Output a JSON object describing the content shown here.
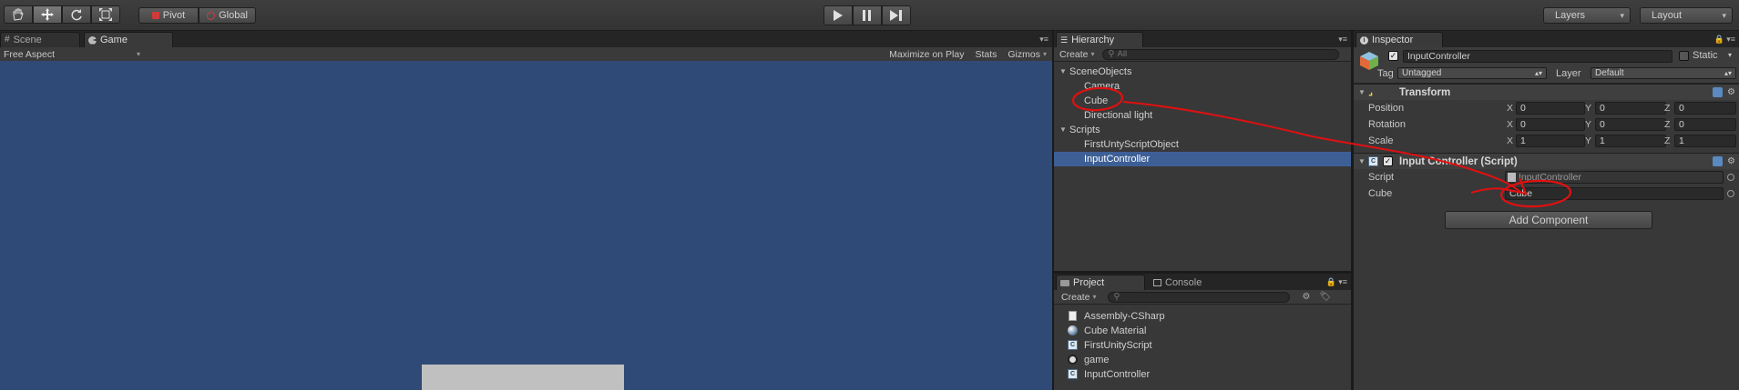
{
  "toolbar": {
    "tools": [
      "hand-tool",
      "move-tool",
      "rotate-tool",
      "scale-tool"
    ],
    "pivot_label": "Pivot",
    "global_label": "Global",
    "layers_label": "Layers",
    "layout_label": "Layout"
  },
  "scene_panel": {
    "tabs": {
      "scene": "Scene",
      "game": "Game"
    },
    "aspect": "Free Aspect",
    "maximize": "Maximize on Play",
    "stats": "Stats",
    "gizmos": "Gizmos"
  },
  "hierarchy": {
    "title": "Hierarchy",
    "create": "Create",
    "search_placeholder": "All",
    "items": [
      {
        "label": "SceneObjects"
      },
      {
        "label": "Camera"
      },
      {
        "label": "Cube"
      },
      {
        "label": "Directional light"
      },
      {
        "label": "Scripts"
      },
      {
        "label": "FirstUntyScriptObject"
      },
      {
        "label": "InputController"
      }
    ]
  },
  "project": {
    "tabs": {
      "project": "Project",
      "console": "Console"
    },
    "create": "Create",
    "items": [
      {
        "label": "Assembly-CSharp",
        "icon": "document-icon"
      },
      {
        "label": "Cube Material",
        "icon": "material-sphere-icon"
      },
      {
        "label": "FirstUnityScript",
        "icon": "csharp-script-icon"
      },
      {
        "label": "game",
        "icon": "unity-scene-icon"
      },
      {
        "label": "InputController",
        "icon": "csharp-script-icon"
      }
    ]
  },
  "inspector": {
    "title": "Inspector",
    "object_name": "InputController",
    "static_label": "Static",
    "tag_label": "Tag",
    "tag_value": "Untagged",
    "layer_label": "Layer",
    "layer_value": "Default",
    "transform": {
      "title": "Transform",
      "position_label": "Position",
      "rotation_label": "Rotation",
      "scale_label": "Scale",
      "position": {
        "x": "0",
        "y": "0",
        "z": "0"
      },
      "rotation": {
        "x": "0",
        "y": "0",
        "z": "0"
      },
      "scale": {
        "x": "1",
        "y": "1",
        "z": "1"
      },
      "axis_x": "X",
      "axis_y": "Y",
      "axis_z": "Z"
    },
    "script_component": {
      "title": "Input Controller (Script)",
      "script_label": "Script",
      "script_value": "InputController",
      "cube_label": "Cube",
      "cube_value": "Cube"
    },
    "add_component": "Add Component"
  },
  "colors": {
    "annotation": "#e01010",
    "selection": "#3d5f96",
    "game_background": "#2f4a76"
  }
}
